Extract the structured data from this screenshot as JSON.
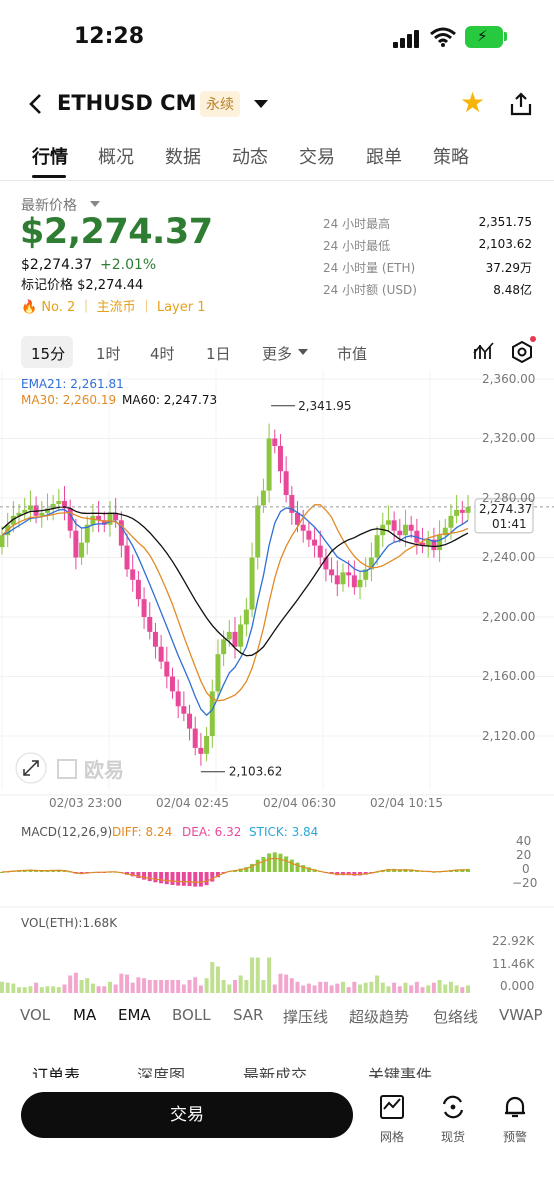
{
  "status": {
    "time": "12:28"
  },
  "header": {
    "title": "ETHUSD CM",
    "badge": "永续"
  },
  "tabs": [
    "行情",
    "概况",
    "数据",
    "动态",
    "交易",
    "跟单",
    "策略"
  ],
  "price": {
    "latest_label": "最新价格",
    "big": "$2,274.37",
    "sub": "$2,274.37",
    "change": "+2.01%",
    "mark": "标记价格 $2,274.44",
    "tags": "No. 2 ｜ 主流币 ｜ Layer 1"
  },
  "stats": [
    {
      "label": "24 小时最高",
      "value": "2,351.75"
    },
    {
      "label": "24 小时最低",
      "value": "2,103.62"
    },
    {
      "label": "24 小时量 (ETH)",
      "value": "37.29万"
    },
    {
      "label": "24 小时额 (USD)",
      "value": "8.48亿"
    }
  ],
  "timeframes": [
    "15分",
    "1时",
    "4时",
    "1日",
    "更多",
    "市值"
  ],
  "legend": {
    "ema21": "EMA21: 2,261.81",
    "ma30": "MA30: 2,260.19",
    "ma60": "MA60: 2,247.73"
  },
  "colors": {
    "up": "#8cc63f",
    "down": "#e9489a",
    "ema": "#2f6fd6",
    "ma30": "#e18a26",
    "ma60": "#111111",
    "price_green": "#2e7d32"
  },
  "chart_data": {
    "type": "candlestick",
    "ylim": [
      2090,
      2370
    ],
    "yticks": [
      "2,360.00",
      "2,320.00",
      "2,280.00",
      "2,240.00",
      "2,200.00",
      "2,160.00",
      "2,120.00"
    ],
    "xticks": [
      "02/03 23:00",
      "02/04 02:45",
      "02/04 06:30",
      "02/04 10:15"
    ],
    "high_label": "2,341.95",
    "low_label": "2,103.62",
    "current_price": "2,274.37",
    "countdown": "01:41",
    "watermark": "欧易",
    "closes": [
      2255,
      2262,
      2268,
      2270,
      2272,
      2275,
      2268,
      2270,
      2273,
      2276,
      2278,
      2273,
      2258,
      2240,
      2250,
      2262,
      2268,
      2265,
      2262,
      2270,
      2265,
      2248,
      2232,
      2225,
      2212,
      2200,
      2190,
      2180,
      2170,
      2160,
      2150,
      2140,
      2135,
      2125,
      2112,
      2108,
      2120,
      2150,
      2175,
      2185,
      2190,
      2180,
      2195,
      2205,
      2240,
      2275,
      2285,
      2320,
      2315,
      2298,
      2282,
      2270,
      2262,
      2258,
      2252,
      2248,
      2240,
      2232,
      2228,
      2222,
      2230,
      2228,
      2220,
      2225,
      2232,
      2240,
      2255,
      2262,
      2265,
      2258,
      2255,
      2262,
      2258,
      2250,
      2248,
      2252,
      2245,
      2255,
      2260,
      2268,
      2272,
      2270,
      2274
    ]
  },
  "macd": {
    "label": "MACD(12,26,9)",
    "diff": "DIFF: 8.24",
    "dea": "DEA: 6.32",
    "stick": "STICK: 3.84",
    "ticks": [
      "40",
      "20",
      "0",
      "−20"
    ]
  },
  "vol": {
    "label": "VOL(ETH):1.68K",
    "ticks": [
      "22.92K",
      "11.46K",
      "0.000"
    ]
  },
  "indicator_tabs": [
    "VOL",
    "MA",
    "EMA",
    "BOLL",
    "SAR",
    "撑压线",
    "超级趋势",
    "包络线",
    "VWAP"
  ],
  "bottom_tabs": [
    "订单表",
    "深度图",
    "最新成交",
    "关键事件"
  ],
  "footer": {
    "trade": "交易",
    "grid": "网格",
    "spot": "现货",
    "alert": "预警"
  }
}
